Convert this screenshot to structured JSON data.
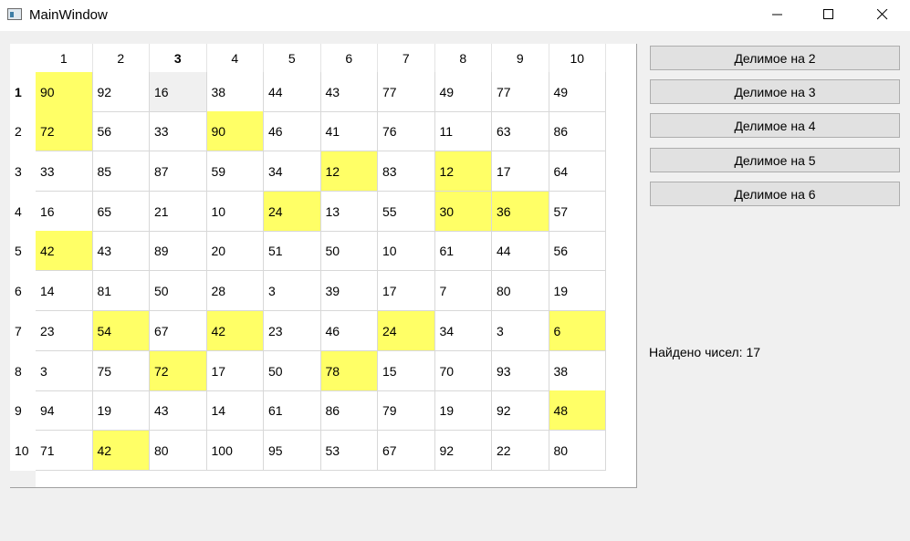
{
  "window": {
    "title": "MainWindow"
  },
  "table": {
    "column_headers": [
      "1",
      "2",
      "3",
      "4",
      "5",
      "6",
      "7",
      "8",
      "9",
      "10"
    ],
    "row_headers": [
      "1",
      "2",
      "3",
      "4",
      "5",
      "6",
      "7",
      "8",
      "9",
      "10"
    ],
    "current_cell": {
      "row": 1,
      "column": 3
    },
    "highlight_color": "#ffff66",
    "rows": [
      {
        "values": [
          "90",
          "92",
          "16",
          "38",
          "44",
          "43",
          "77",
          "49",
          "77",
          "49"
        ],
        "highlighted": [
          true,
          false,
          false,
          false,
          false,
          false,
          false,
          false,
          false,
          false
        ]
      },
      {
        "values": [
          "72",
          "56",
          "33",
          "90",
          "46",
          "41",
          "76",
          "11",
          "63",
          "86"
        ],
        "highlighted": [
          true,
          false,
          false,
          true,
          false,
          false,
          false,
          false,
          false,
          false
        ]
      },
      {
        "values": [
          "33",
          "85",
          "87",
          "59",
          "34",
          "12",
          "83",
          "12",
          "17",
          "64"
        ],
        "highlighted": [
          false,
          false,
          false,
          false,
          false,
          true,
          false,
          true,
          false,
          false
        ]
      },
      {
        "values": [
          "16",
          "65",
          "21",
          "10",
          "24",
          "13",
          "55",
          "30",
          "36",
          "57"
        ],
        "highlighted": [
          false,
          false,
          false,
          false,
          true,
          false,
          false,
          true,
          true,
          false
        ]
      },
      {
        "values": [
          "42",
          "43",
          "89",
          "20",
          "51",
          "50",
          "10",
          "61",
          "44",
          "56"
        ],
        "highlighted": [
          true,
          false,
          false,
          false,
          false,
          false,
          false,
          false,
          false,
          false
        ]
      },
      {
        "values": [
          "14",
          "81",
          "50",
          "28",
          "3",
          "39",
          "17",
          "7",
          "80",
          "19"
        ],
        "highlighted": [
          false,
          false,
          false,
          false,
          false,
          false,
          false,
          false,
          false,
          false
        ]
      },
      {
        "values": [
          "23",
          "54",
          "67",
          "42",
          "23",
          "46",
          "24",
          "34",
          "3",
          "6"
        ],
        "highlighted": [
          false,
          true,
          false,
          true,
          false,
          false,
          true,
          false,
          false,
          true
        ]
      },
      {
        "values": [
          "3",
          "75",
          "72",
          "17",
          "50",
          "78",
          "15",
          "70",
          "93",
          "38"
        ],
        "highlighted": [
          false,
          false,
          true,
          false,
          false,
          true,
          false,
          false,
          false,
          false
        ]
      },
      {
        "values": [
          "94",
          "19",
          "43",
          "14",
          "61",
          "86",
          "79",
          "19",
          "92",
          "48"
        ],
        "highlighted": [
          false,
          false,
          false,
          false,
          false,
          false,
          false,
          false,
          false,
          true
        ]
      },
      {
        "values": [
          "71",
          "42",
          "80",
          "100",
          "95",
          "53",
          "67",
          "92",
          "22",
          "80"
        ],
        "highlighted": [
          false,
          true,
          false,
          false,
          false,
          false,
          false,
          false,
          false,
          false
        ]
      }
    ]
  },
  "buttons": [
    {
      "label": "Делимое на 2"
    },
    {
      "label": "Делимое на 3"
    },
    {
      "label": "Делимое на 4"
    },
    {
      "label": "Делимое на 5"
    },
    {
      "label": "Делимое на 6"
    }
  ],
  "status": {
    "found_text": "Найдено чисел: 17"
  }
}
